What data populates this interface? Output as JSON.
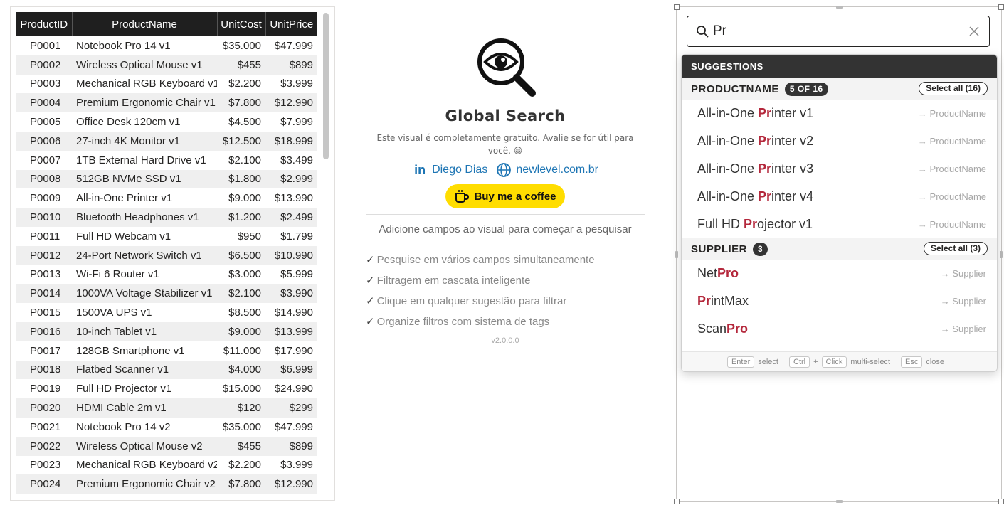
{
  "table": {
    "columns": [
      "ProductID",
      "ProductName",
      "UnitCost",
      "UnitPrice"
    ],
    "rows": [
      [
        "P0001",
        "Notebook Pro 14 v1",
        "$35.000",
        "$47.999"
      ],
      [
        "P0002",
        "Wireless Optical Mouse v1",
        "$455",
        "$899"
      ],
      [
        "P0003",
        "Mechanical RGB Keyboard v1",
        "$2.200",
        "$3.999"
      ],
      [
        "P0004",
        "Premium Ergonomic Chair v1",
        "$7.800",
        "$12.990"
      ],
      [
        "P0005",
        "Office Desk 120cm v1",
        "$4.500",
        "$7.999"
      ],
      [
        "P0006",
        "27-inch 4K Monitor v1",
        "$12.500",
        "$18.999"
      ],
      [
        "P0007",
        "1TB External Hard Drive v1",
        "$2.100",
        "$3.499"
      ],
      [
        "P0008",
        "512GB NVMe SSD v1",
        "$1.800",
        "$2.999"
      ],
      [
        "P0009",
        "All-in-One Printer v1",
        "$9.000",
        "$13.990"
      ],
      [
        "P0010",
        "Bluetooth Headphones v1",
        "$1.200",
        "$2.499"
      ],
      [
        "P0011",
        "Full HD Webcam v1",
        "$950",
        "$1.799"
      ],
      [
        "P0012",
        "24-Port Network Switch v1",
        "$6.500",
        "$10.990"
      ],
      [
        "P0013",
        "Wi-Fi 6 Router v1",
        "$3.000",
        "$5.999"
      ],
      [
        "P0014",
        "1000VA Voltage Stabilizer v1",
        "$2.100",
        "$3.990"
      ],
      [
        "P0015",
        "1500VA UPS v1",
        "$8.500",
        "$14.990"
      ],
      [
        "P0016",
        "10-inch Tablet v1",
        "$9.000",
        "$13.999"
      ],
      [
        "P0017",
        "128GB Smartphone v1",
        "$11.000",
        "$17.990"
      ],
      [
        "P0018",
        "Flatbed Scanner v1",
        "$4.000",
        "$6.999"
      ],
      [
        "P0019",
        "Full HD Projector v1",
        "$15.000",
        "$24.990"
      ],
      [
        "P0020",
        "HDMI Cable 2m v1",
        "$120",
        "$299"
      ],
      [
        "P0021",
        "Notebook Pro 14 v2",
        "$35.000",
        "$47.999"
      ],
      [
        "P0022",
        "Wireless Optical Mouse v2",
        "$455",
        "$899"
      ],
      [
        "P0023",
        "Mechanical RGB Keyboard v2",
        "$2.200",
        "$3.999"
      ],
      [
        "P0024",
        "Premium Ergonomic Chair v2",
        "$7.800",
        "$12.990"
      ]
    ]
  },
  "info": {
    "logo_icon": "magnifier-eye-icon",
    "title": "Global Search",
    "description": "Este visual é completamente gratuito. Avalie se for útil para você. 😁",
    "linkedin_icon": "linkedin-icon",
    "author": "Diego Dias",
    "globe_icon": "globe-icon",
    "website": "newlevel.com.br",
    "coffee_icon": "coffee-cup-icon",
    "coffee_button": "Buy me a coffee",
    "empty_hint": "Adicione campos ao visual para começar a pesquisar",
    "features": [
      "Pesquise em vários campos simultaneamente",
      "Filtragem em cascata inteligente",
      "Clique em qualquer sugestão para filtrar",
      "Organize filtros com sistema de tags"
    ],
    "check_mark": "✓",
    "version": "v2.0.0.0"
  },
  "search": {
    "query": "Pr",
    "search_icon": "search-icon",
    "clear_icon": "close-icon",
    "suggestions_header": "SUGGESTIONS",
    "groups": [
      {
        "title": "PRODUCTNAME",
        "badge": "5 OF 16",
        "select_all": "Select all (16)",
        "items": [
          {
            "pre": "All-in-One ",
            "hl": "Pr",
            "post": "inter v1",
            "field": "→ ProductName"
          },
          {
            "pre": "All-in-One ",
            "hl": "Pr",
            "post": "inter v2",
            "field": "→ ProductName"
          },
          {
            "pre": "All-in-One ",
            "hl": "Pr",
            "post": "inter v3",
            "field": "→ ProductName"
          },
          {
            "pre": "All-in-One ",
            "hl": "Pr",
            "post": "inter v4",
            "field": "→ ProductName"
          },
          {
            "pre": "Full HD ",
            "hl": "Pr",
            "post": "ojector v1",
            "field": "→ ProductName"
          }
        ]
      },
      {
        "title": "SUPPLIER",
        "badge": "3",
        "select_all": "Select all (3)",
        "items": [
          {
            "pre": "Net",
            "hl": "Pro",
            "post": "",
            "field": "→ Supplier"
          },
          {
            "pre": "",
            "hl": "Pr",
            "post": "intMax",
            "field": "→ Supplier"
          },
          {
            "pre": "Scan",
            "hl": "Pro",
            "post": "",
            "field": "→ Supplier"
          }
        ]
      }
    ],
    "footer": {
      "enter_key": "Enter",
      "enter_text": "select",
      "ctrl_key": "Ctrl",
      "plus": "+",
      "click_key": "Click",
      "click_text": "multi-select",
      "esc_key": "Esc",
      "esc_text": "close"
    }
  }
}
